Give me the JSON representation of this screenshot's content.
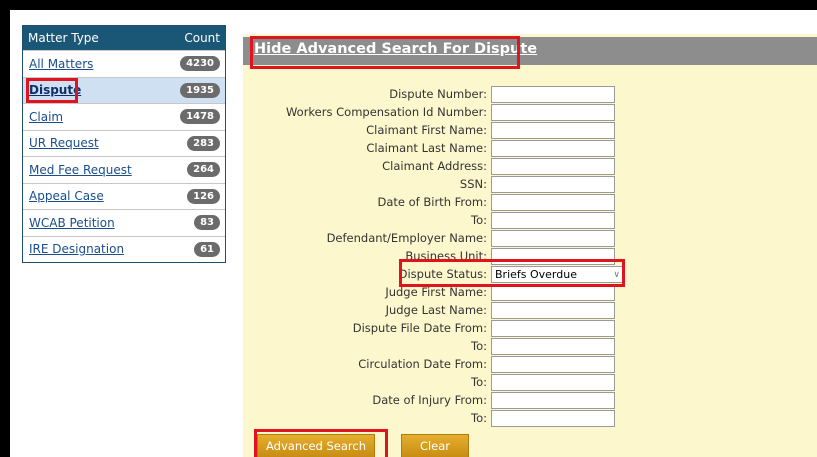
{
  "matter_type": {
    "header_label": "Matter Type",
    "count_label": "Count",
    "items": [
      {
        "label": "All Matters",
        "count": "4230"
      },
      {
        "label": "Dispute",
        "count": "1935"
      },
      {
        "label": "Claim",
        "count": "1478"
      },
      {
        "label": "UR Request",
        "count": "283"
      },
      {
        "label": "Med Fee Request",
        "count": "264"
      },
      {
        "label": "Appeal Case",
        "count": "126"
      },
      {
        "label": "WCAB Petition",
        "count": "83"
      },
      {
        "label": "IRE Designation",
        "count": "61"
      }
    ],
    "active_item": "Dispute"
  },
  "search": {
    "title": "Hide Advanced Search For Dispute",
    "fields": [
      {
        "label": "Dispute Number:",
        "value": ""
      },
      {
        "label": "Workers Compensation Id Number:",
        "value": ""
      },
      {
        "label": "Claimant First Name:",
        "value": ""
      },
      {
        "label": "Claimant Last Name:",
        "value": ""
      },
      {
        "label": "Claimant Address:",
        "value": ""
      },
      {
        "label": "SSN:",
        "value": ""
      },
      {
        "label": "Date of Birth From:",
        "value": ""
      },
      {
        "label": "To:",
        "value": ""
      },
      {
        "label": "Defendant/Employer Name:",
        "value": ""
      },
      {
        "label": "Business Unit:",
        "value": ""
      },
      {
        "label": "Dispute Status:",
        "value": "Briefs Overdue"
      },
      {
        "label": "Judge First Name:",
        "value": ""
      },
      {
        "label": "Judge Last Name:",
        "value": ""
      },
      {
        "label": "Dispute File Date From:",
        "value": ""
      },
      {
        "label": "To:",
        "value": ""
      },
      {
        "label": "Circulation Date From:",
        "value": ""
      },
      {
        "label": "To:",
        "value": ""
      },
      {
        "label": "Date of Injury From:",
        "value": ""
      },
      {
        "label": "To:",
        "value": ""
      }
    ],
    "advanced_button": "Advanced Search",
    "clear_button": "Clear"
  },
  "colors": {
    "header_bg": "#1a5777",
    "highlight_red": "#e0141e",
    "form_bg": "#fdf7cd",
    "button_gold": "#d49a1e",
    "title_bar_gray": "#8d8d8d"
  }
}
